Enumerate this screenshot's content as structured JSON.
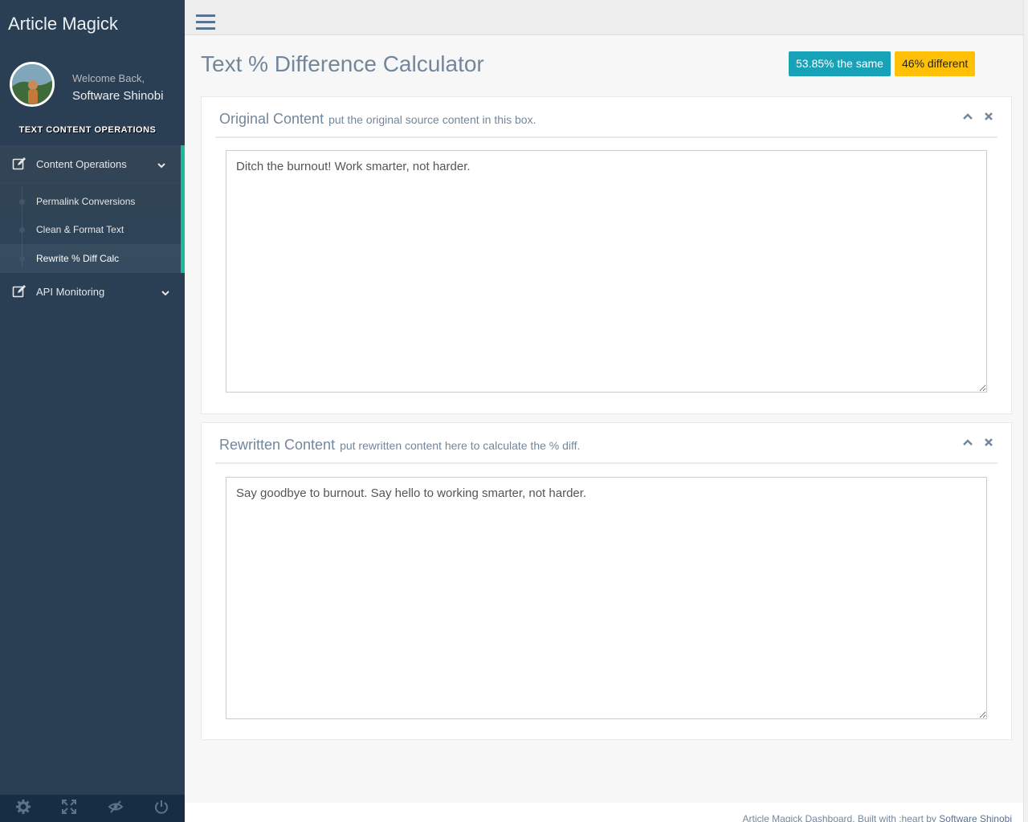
{
  "app": {
    "title": "Article Magick"
  },
  "profile": {
    "welcome": "Welcome Back,",
    "name": "Software Shinobi"
  },
  "sidebar": {
    "section_title": "TEXT CONTENT OPERATIONS",
    "menus": [
      {
        "label": "Content Operations",
        "icon": "edit-icon",
        "expanded": true,
        "items": [
          {
            "label": "Permalink Conversions"
          },
          {
            "label": "Clean & Format Text"
          },
          {
            "label": "Rewrite % Diff Calc",
            "current": true
          }
        ]
      },
      {
        "label": "API Monitoring",
        "icon": "edit-icon",
        "expanded": false
      }
    ],
    "footer_icons": [
      "settings-icon",
      "fullscreen-icon",
      "lock-icon",
      "power-icon"
    ]
  },
  "page": {
    "title": "Text % Difference Calculator",
    "badges": {
      "same": "53.85% the same",
      "different": "46% different"
    }
  },
  "panels": {
    "original": {
      "title": "Original Content",
      "subtitle": "put the original source content in this box.",
      "text": "Ditch the burnout! Work smarter, not harder."
    },
    "rewritten": {
      "title": "Rewritten Content",
      "subtitle": "put rewritten content here to calculate the % diff.",
      "text": "Say goodbye to burnout. Say hello to working smarter, not harder."
    }
  },
  "footer": {
    "text": "Article Magick Dashboard. Built with :heart by ",
    "link": "Software Shinobi"
  },
  "colors": {
    "sidebar": "#2a3f54",
    "accent": "#1abb9c",
    "badge_same": "#17a2b8",
    "badge_diff": "#ffc107"
  }
}
